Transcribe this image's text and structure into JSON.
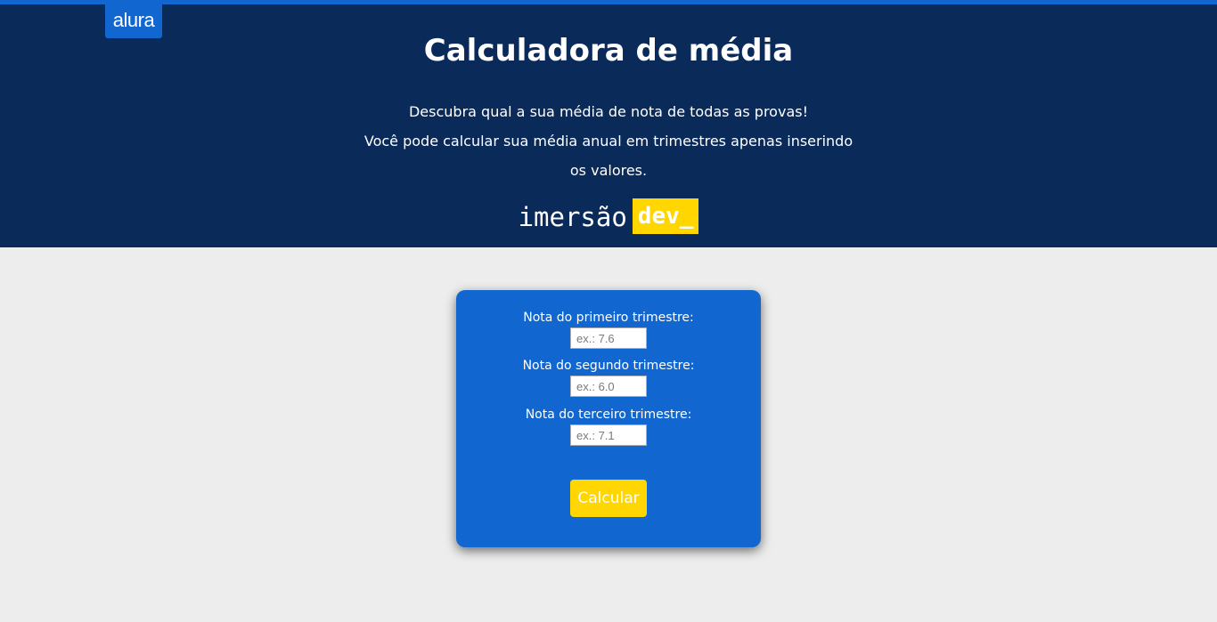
{
  "header": {
    "logo_text": "alura",
    "title": "Calculadora de média",
    "description_lines": [
      "Descubra qual a sua média de nota de todas as provas!",
      "Você pode calcular sua média anual em trimestres apenas inserindo",
      "os valores."
    ],
    "brand_word": "imersão",
    "brand_tag": "dev_"
  },
  "form": {
    "fields": [
      {
        "label": "Nota do primeiro trimestre:",
        "placeholder": "ex.: 7.6"
      },
      {
        "label": "Nota do segundo trimestre:",
        "placeholder": "ex.: 6.0"
      },
      {
        "label": "Nota do terceiro trimestre:",
        "placeholder": "ex.: 7.1"
      }
    ],
    "button_label": "Calcular"
  },
  "colors": {
    "header_bg": "#0a2a5a",
    "accent_blue": "#1266cf",
    "accent_yellow": "#ffd600",
    "page_bg": "#ededed"
  }
}
